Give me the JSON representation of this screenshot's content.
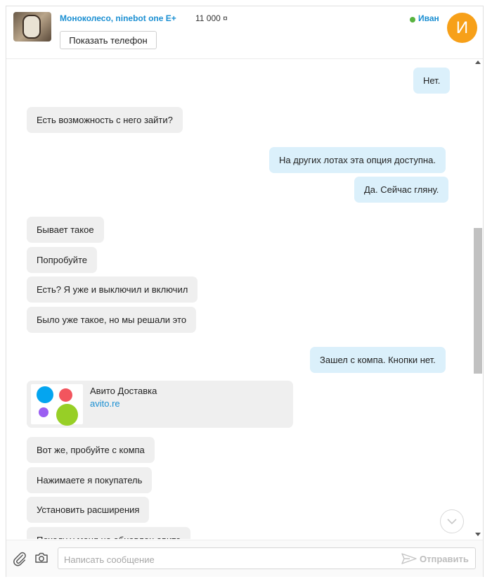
{
  "header": {
    "item_title": "Моноколесо, ninebot one E+",
    "item_price": "11 000 ¤",
    "show_phone": "Показать телефон",
    "user_name": "Иван",
    "avatar_letter": "И"
  },
  "messages": [
    {
      "dir": "out",
      "text": "Нет."
    },
    {
      "dir": "in",
      "text": "Есть возможность с него зайти?"
    },
    {
      "dir": "out",
      "text": "На других лотах эта опция доступна."
    },
    {
      "dir": "out",
      "text": "Да. Сейчас гляну."
    },
    {
      "dir": "in",
      "text": "Бывает такое"
    },
    {
      "dir": "in",
      "text": "Попробуйте"
    },
    {
      "dir": "in",
      "text": "Есть? Я уже и выключил и включил"
    },
    {
      "dir": "in",
      "text": "Было уже такое, но мы решали это"
    },
    {
      "dir": "out",
      "text": "Зашел с компа. Кнопки нет."
    },
    {
      "dir": "in",
      "text": "Вот же, пробуйте с компа"
    },
    {
      "dir": "in",
      "text": "Нажимаете я покупатель"
    },
    {
      "dir": "in",
      "text": "Установить расширения"
    },
    {
      "dir": "in",
      "text": "Походу у меня не обновлен авито"
    }
  ],
  "link_card": {
    "title": "Авито Доставка",
    "url": "avito.re"
  },
  "composer": {
    "placeholder": "Написать сообщение",
    "value": "",
    "send_label": "Отправить"
  },
  "colors": {
    "accent": "#1b8fd2",
    "incoming_bubble": "#efefef",
    "outgoing_bubble": "#dbf0fb",
    "avatar": "#f7a019",
    "online": "#58b33f"
  },
  "icons": [
    "attach-icon",
    "camera-icon",
    "send-icon",
    "chevron-down-icon"
  ]
}
